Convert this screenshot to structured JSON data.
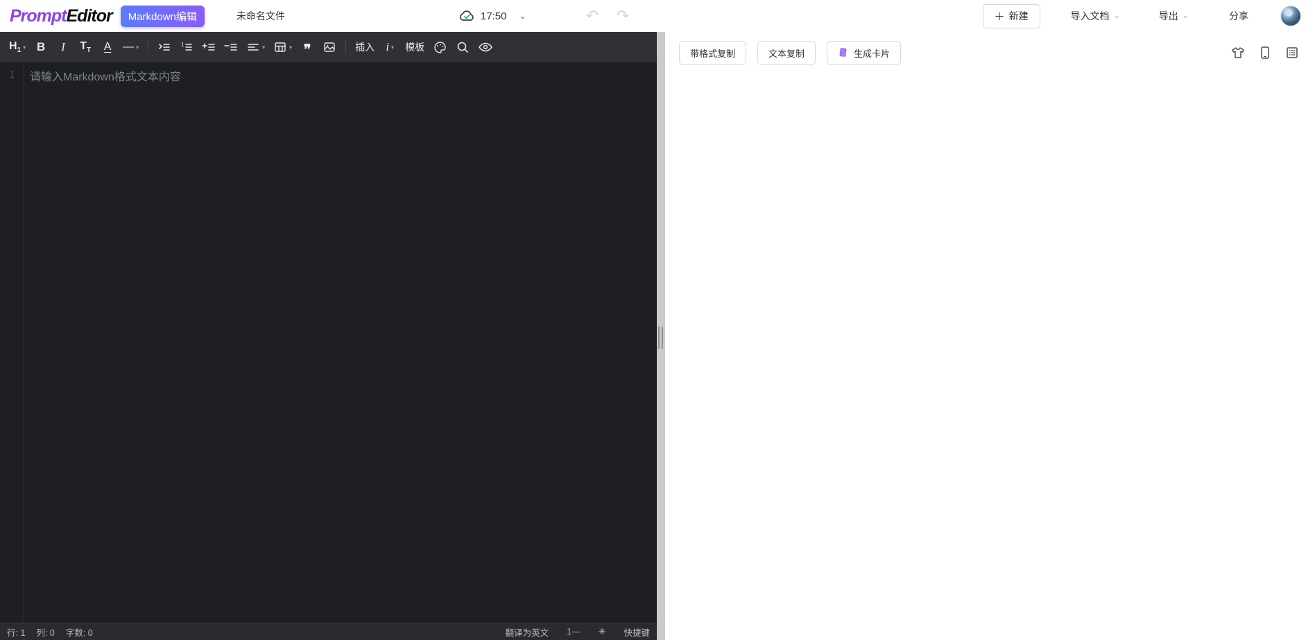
{
  "topbar": {
    "logo_prompt": "Prompt",
    "logo_editor": "Editor",
    "badge": "Markdown编辑",
    "file_name": "未命名文件",
    "save_time": "17:50",
    "undo_glyph": "↶",
    "redo_glyph": "↷",
    "plus_glyph": "＋",
    "new_label": "新建",
    "import_label": "导入文档",
    "export_label": "导出",
    "share_label": "分享",
    "chevron_glyph": "⌄"
  },
  "toolbar": {
    "heading_main": "H",
    "heading_sub": "1",
    "bold": "B",
    "italic": "I",
    "fontsize_main": "T",
    "fontsize_sub": "T",
    "underline": "A",
    "divider": "—",
    "quote_glyph": "❞",
    "insert_label": "插入",
    "i_label": "i",
    "template_label": "模板",
    "caret_glyph": "▾"
  },
  "editor": {
    "line_number": "1",
    "placeholder": "请输入Markdown格式文本内容"
  },
  "statusbar": {
    "line": "行: 1",
    "column": "列: 0",
    "words": "字数: 0",
    "translate": "翻译为英文",
    "fontsize": "1—",
    "theme_glyph": "✳",
    "shortcuts": "快捷键"
  },
  "preview": {
    "copy_formatted": "带格式复制",
    "copy_text": "文本复制",
    "generate_card": "生成卡片"
  },
  "colors": {
    "accent_purple": "#8a5cf6",
    "accent_blue": "#5b7cfa",
    "editor_bg": "#1d1f24",
    "toolbar_bg": "#303136",
    "statusbar_bg": "#2a2b31",
    "save_check_green": "#10b981"
  }
}
